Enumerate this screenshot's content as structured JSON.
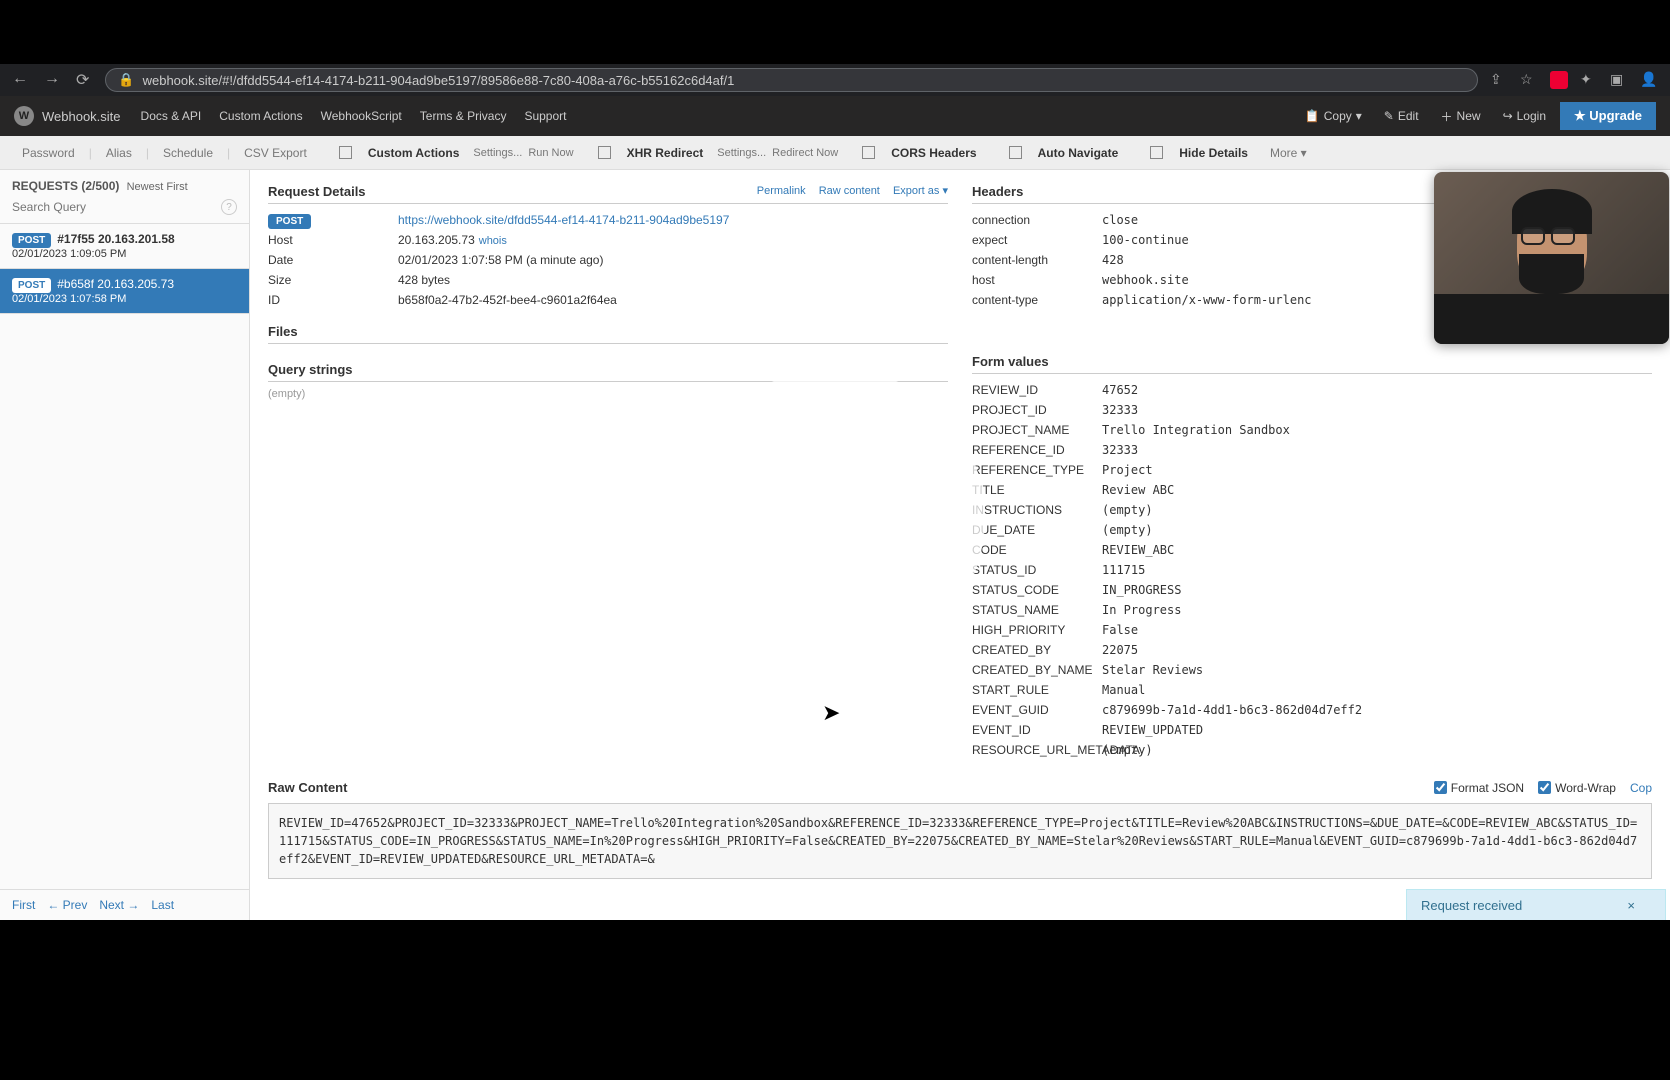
{
  "browser": {
    "url": "webhook.site/#!/dfdd5544-ef14-4174-b211-904ad9be5197/89586e88-7c80-408a-a76c-b55162c6d4af/1"
  },
  "brand": {
    "name": "Webhook.site"
  },
  "nav": {
    "docs": "Docs & API",
    "custom_actions": "Custom Actions",
    "webhookscript": "WebhookScript",
    "terms": "Terms & Privacy",
    "support": "Support",
    "copy": "Copy",
    "edit": "Edit",
    "new": "New",
    "login": "Login",
    "upgrade": "★ Upgrade"
  },
  "toolbar": {
    "password": "Password",
    "alias": "Alias",
    "schedule": "Schedule",
    "csv_export": "CSV Export",
    "custom_actions": "Custom Actions",
    "settings1": "Settings...",
    "runnow": "Run Now",
    "xhr": "XHR Redirect",
    "settings2": "Settings...",
    "redirect": "Redirect Now",
    "cors": "CORS Headers",
    "autonav": "Auto Navigate",
    "hidedetails": "Hide Details",
    "more": "More"
  },
  "sidebar": {
    "title": "REQUESTS (2/500)",
    "sort": "Newest First",
    "search_ph": "Search Query",
    "items": [
      {
        "method": "POST",
        "hash": "#17f55",
        "ip": "20.163.201.58",
        "date": "02/01/2023 1:09:05 PM"
      },
      {
        "method": "POST",
        "hash": "#b658f",
        "ip": "20.163.205.73",
        "date": "02/01/2023 1:07:58 PM"
      }
    ],
    "pager": {
      "first": "First",
      "prev": "← Prev",
      "next": "Next →",
      "last": "Last"
    }
  },
  "details": {
    "title": "Request Details",
    "permalink": "Permalink",
    "rawcontent": "Raw content",
    "exportas": "Export as",
    "method": "POST",
    "url": "https://webhook.site/dfdd5544-ef14-4174-b211-904ad9be5197",
    "host_label": "Host",
    "host": "20.163.205.73",
    "whois": "whois",
    "date_label": "Date",
    "date": "02/01/2023 1:07:58 PM (a minute ago)",
    "size_label": "Size",
    "size": "428 bytes",
    "id_label": "ID",
    "id": "b658f0a2-47b2-452f-bee4-c9601a2f64ea",
    "files_title": "Files",
    "qs_title": "Query strings",
    "qs_empty": "(empty)"
  },
  "headers": {
    "title": "Headers",
    "rows": [
      {
        "k": "connection",
        "v": "close"
      },
      {
        "k": "expect",
        "v": "100-continue"
      },
      {
        "k": "content-length",
        "v": "428"
      },
      {
        "k": "host",
        "v": "webhook.site"
      },
      {
        "k": "content-type",
        "v": "application/x-www-form-urlenc"
      }
    ]
  },
  "form": {
    "title": "Form values",
    "rows": [
      {
        "k": "REVIEW_ID",
        "v": "47652"
      },
      {
        "k": "PROJECT_ID",
        "v": "32333"
      },
      {
        "k": "PROJECT_NAME",
        "v": "Trello Integration Sandbox"
      },
      {
        "k": "REFERENCE_ID",
        "v": "32333"
      },
      {
        "k": "REFERENCE_TYPE",
        "v": "Project"
      },
      {
        "k": "TITLE",
        "v": "Review ABC"
      },
      {
        "k": "INSTRUCTIONS",
        "v": "(empty)"
      },
      {
        "k": "DUE_DATE",
        "v": "(empty)"
      },
      {
        "k": "CODE",
        "v": "REVIEW_ABC"
      },
      {
        "k": "STATUS_ID",
        "v": "111715"
      },
      {
        "k": "STATUS_CODE",
        "v": "IN_PROGRESS"
      },
      {
        "k": "STATUS_NAME",
        "v": "In Progress"
      },
      {
        "k": "HIGH_PRIORITY",
        "v": "False"
      },
      {
        "k": "CREATED_BY",
        "v": "22075"
      },
      {
        "k": "CREATED_BY_NAME",
        "v": "Stelar Reviews"
      },
      {
        "k": "START_RULE",
        "v": "Manual"
      },
      {
        "k": "EVENT_GUID",
        "v": "c879699b-7a1d-4dd1-b6c3-862d04d7eff2"
      },
      {
        "k": "EVENT_ID",
        "v": "REVIEW_UPDATED"
      },
      {
        "k": "RESOURCE_URL_METADATA",
        "v": "(empty)"
      }
    ]
  },
  "raw": {
    "title": "Raw Content",
    "format_json": "Format JSON",
    "word_wrap": "Word-Wrap",
    "copy": "Cop",
    "body": "REVIEW_ID=47652&PROJECT_ID=32333&PROJECT_NAME=Trello%20Integration%20Sandbox&REFERENCE_ID=32333&REFERENCE_TYPE=Project&TITLE=Review%20ABC&INSTRUCTIONS=&DUE_DATE=&CODE=REVIEW_ABC&STATUS_ID=111715&STATUS_CODE=IN_PROGRESS&STATUS_NAME=In%20Progress&HIGH_PRIORITY=False&CREATED_BY=22075&CREATED_BY_NAME=Stelar%20Reviews&START_RULE=Manual&EVENT_GUID=c879699b-7a1d-4dd1-b6c3-862d04d7eff2&EVENT_ID=REVIEW_UPDATED&RESOURCE_URL_METADATA=&"
  },
  "toast": {
    "msg": "Request received"
  }
}
